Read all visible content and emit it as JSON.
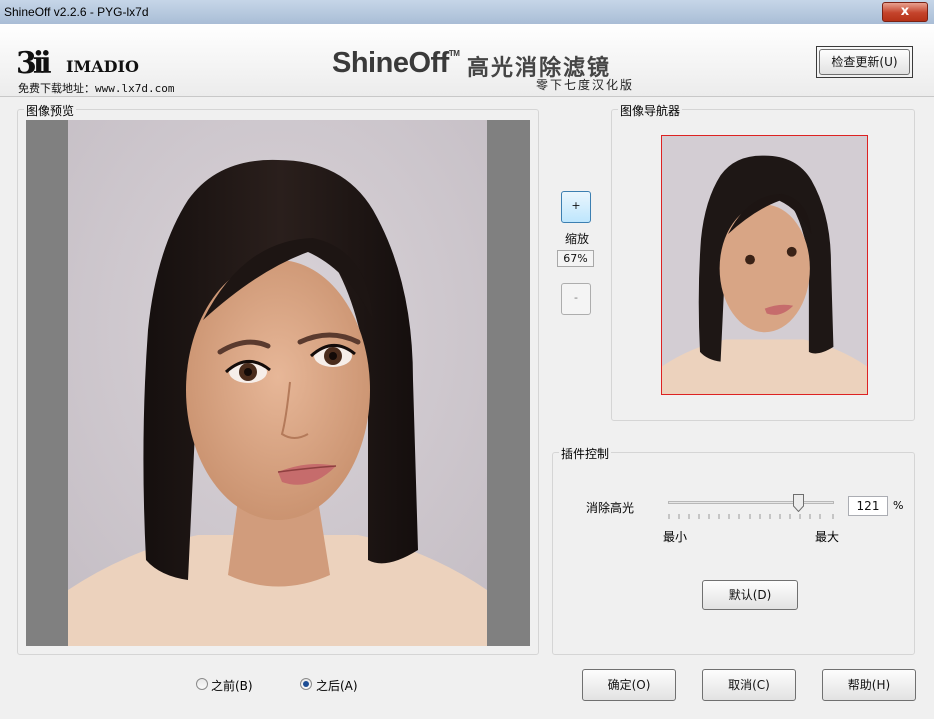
{
  "window": {
    "title": "ShineOff v2.2.6 - PYG-lx7d",
    "close_label": "x"
  },
  "header": {
    "logo_mark": "3ii",
    "logo_name": "IMADIO",
    "download_text": "免费下载地址：www.lx7d.com",
    "brand_title": "ShineOff",
    "brand_tm": "TM",
    "brand_cn": "高光消除滤镜",
    "subtitle": "零下七度汉化版",
    "update_button": "检查更新(U)"
  },
  "preview": {
    "label": "图像预览"
  },
  "zoom": {
    "plus_label": "+",
    "label": "缩放",
    "value": "67%",
    "minus_label": "-"
  },
  "navigator": {
    "label": "图像导航器"
  },
  "controls": {
    "label": "插件控制",
    "highlight_label": "消除高光",
    "slider_value": 121,
    "value_text": "121",
    "unit": "%",
    "min_label": "最小",
    "max_label": "最大",
    "default_button": "默认(D)"
  },
  "view_mode": {
    "before_label": "之前(B)",
    "after_label": "之后(A)",
    "selected": "after"
  },
  "footer": {
    "ok_button": "确定(O)",
    "cancel_button": "取消(C)",
    "help_button": "帮助(H)"
  },
  "colors": {
    "navigator_border": "#dd2222",
    "hair": "#1e1715",
    "skin": "#d8a585",
    "background": "#cfc9cf",
    "close_button": "#c4432b"
  }
}
